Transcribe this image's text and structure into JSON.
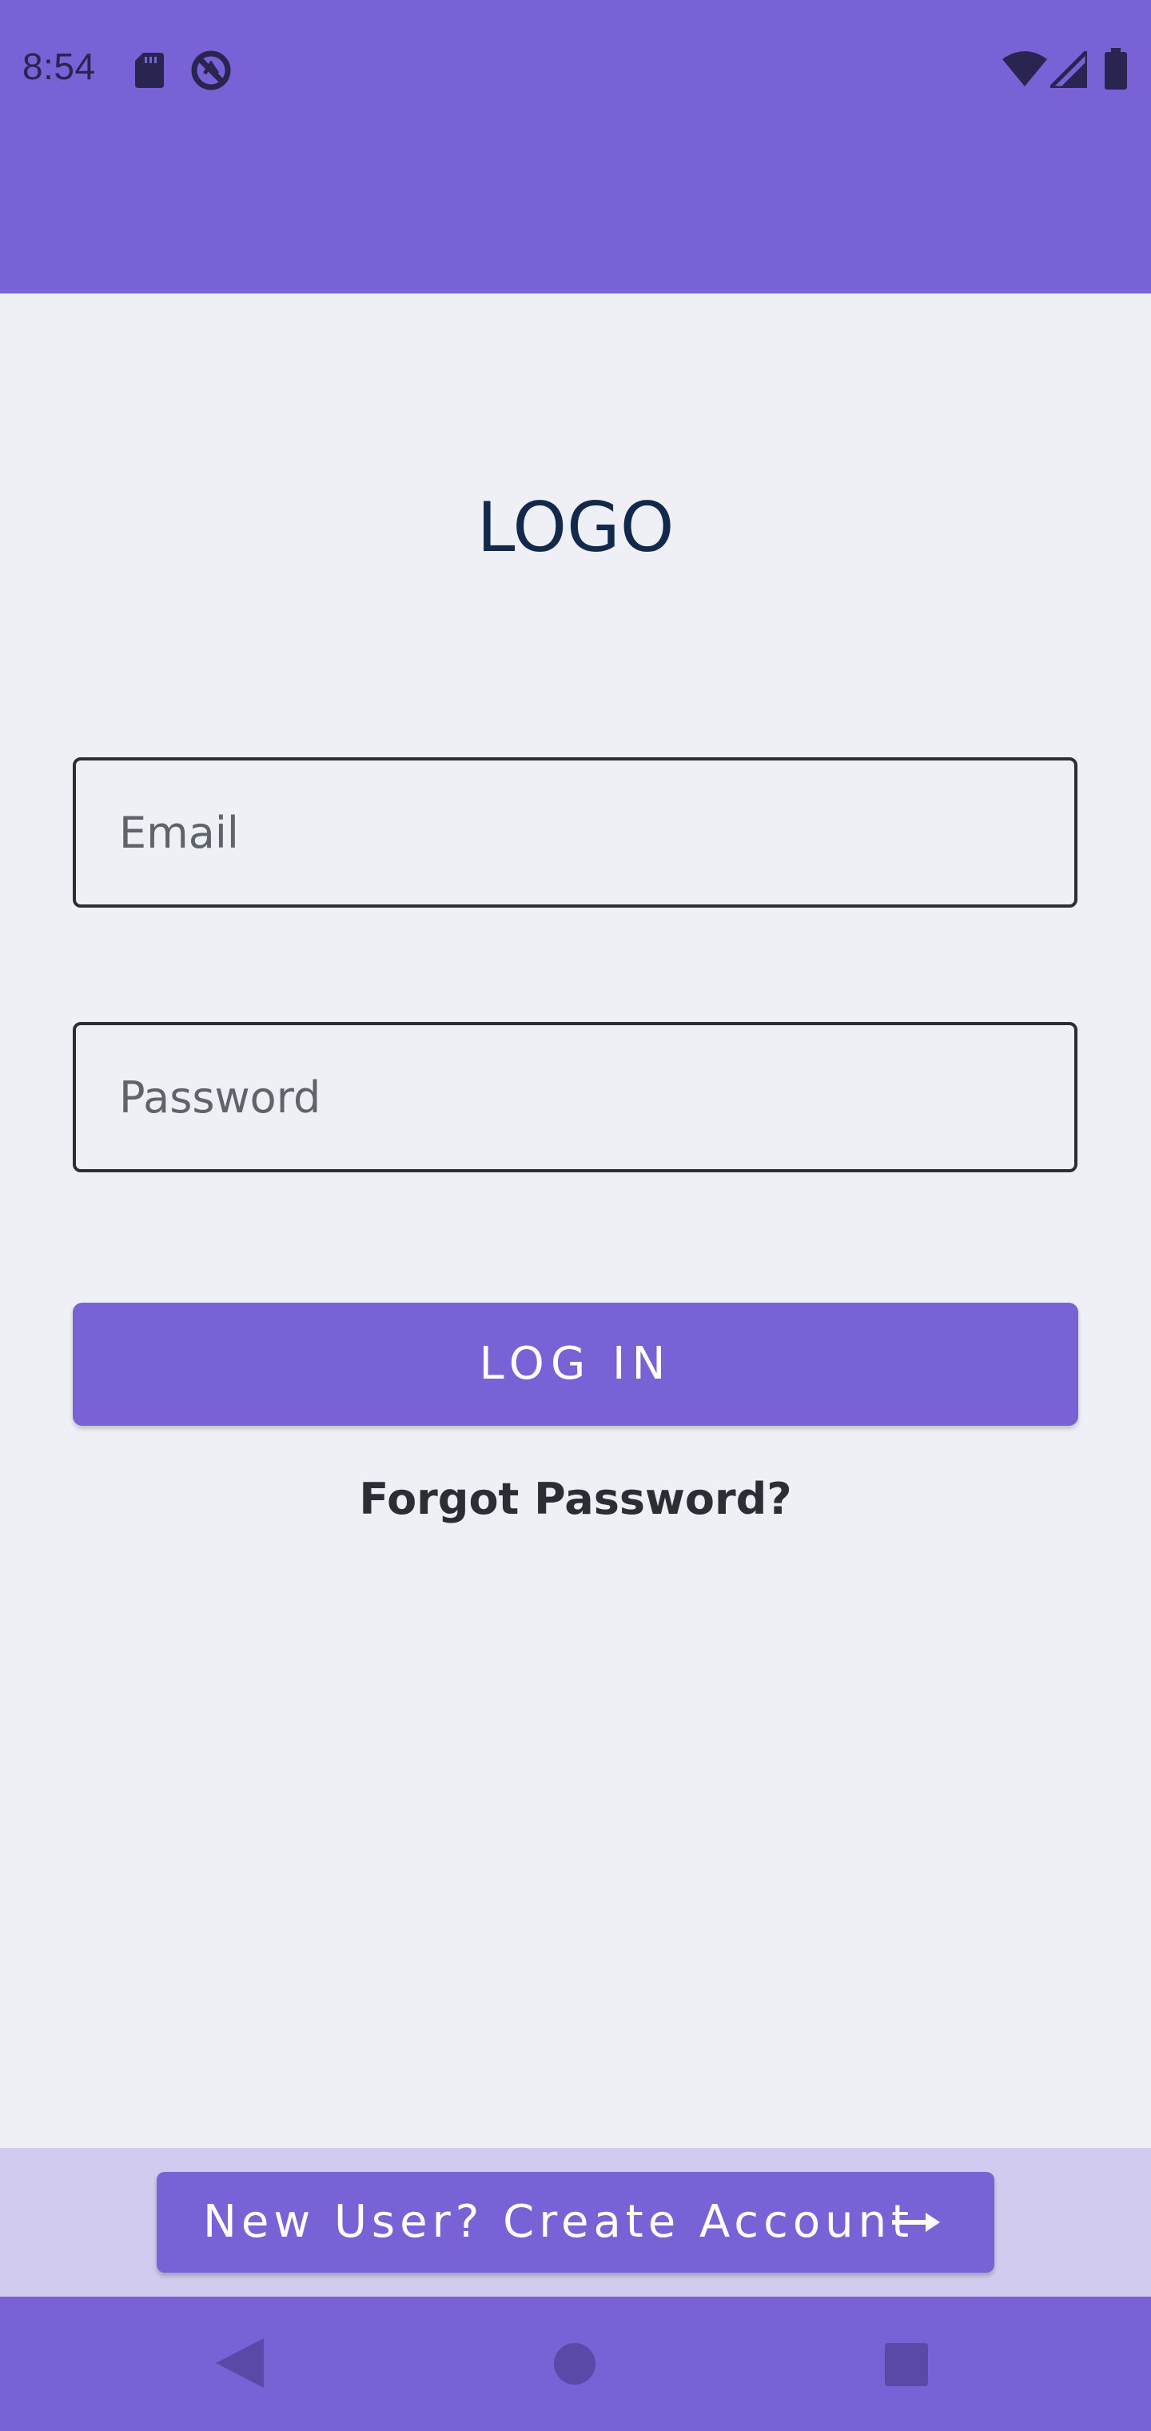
{
  "status_bar": {
    "time": "8:54",
    "icons": [
      "sd-card-icon",
      "no-disturb-icon",
      "wifi-icon",
      "cell-signal-icon",
      "battery-icon"
    ]
  },
  "login_screen": {
    "logo_text": "LOGO",
    "email_placeholder": "Email",
    "password_placeholder": "Password",
    "login_label": "LOG IN",
    "forgot_label": "Forgot Password?",
    "create_account_label": "New User? Create Account"
  },
  "nav_bar": {
    "icons": [
      "back-icon",
      "home-icon",
      "recents-icon"
    ]
  },
  "colors": {
    "primary": "#7962d5",
    "background": "#eff0f5",
    "bottom_band": "#d1ccef",
    "text_dark": "#2b2f35",
    "logo": "#13294b"
  }
}
